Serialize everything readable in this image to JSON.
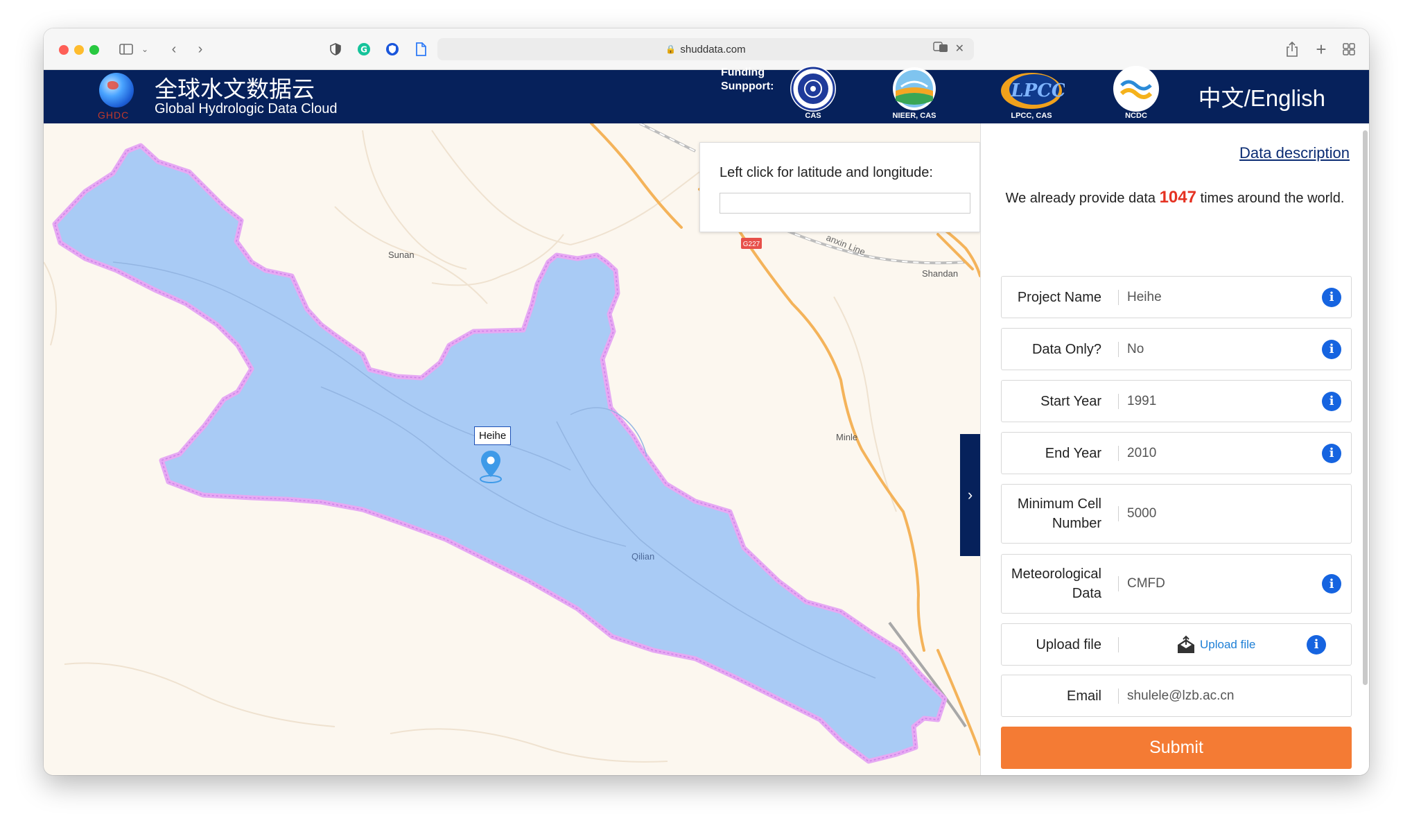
{
  "browser": {
    "url": "shuddata.com"
  },
  "header": {
    "logo_text": "GHDC",
    "title_cn": "全球水文数据云",
    "title_en": "Global Hydrologic Data Cloud",
    "funding_line1": "Funding",
    "funding_line2": "Sunpport:",
    "sponsors": [
      "CAS",
      "NIEER, CAS",
      "LPCC, CAS",
      "NCDC"
    ],
    "language_toggle": "中文/English"
  },
  "map": {
    "coord_prompt": "Left click for latitude and longitude:",
    "coord_value": "",
    "places": [
      "Sunan",
      "Shandan",
      "Minle",
      "Qilian"
    ],
    "road_label": "G227",
    "rail_label": "anxin Line",
    "marker_label": "Heihe"
  },
  "form": {
    "data_description": "Data description",
    "notice_prefix": "We already provide data",
    "notice_count": "1047",
    "notice_suffix": "times around the world.",
    "fields": [
      {
        "label": "Project Name",
        "value": "Heihe",
        "info": true
      },
      {
        "label": "Data Only?",
        "value": "No",
        "info": true
      },
      {
        "label": "Start Year",
        "value": "1991",
        "info": true
      },
      {
        "label": "End Year",
        "value": "2010",
        "info": true
      },
      {
        "label": "Minimum Cell Number",
        "value": "5000",
        "info": false
      },
      {
        "label": "Meteorological Data",
        "value": "CMFD",
        "info": true
      },
      {
        "label": "Upload file",
        "value": "Upload file",
        "info": true
      },
      {
        "label": "Email",
        "value": "shulele@lzb.ac.cn",
        "info": false
      }
    ],
    "submit_label": "Submit"
  },
  "colors": {
    "header_bg": "#06215b",
    "basin_fill": "#a9cbf5",
    "basin_outline": "#e6a9f3",
    "submit_bg": "#f47b34",
    "count_color": "#e53222",
    "info_blue": "#1664e0"
  }
}
